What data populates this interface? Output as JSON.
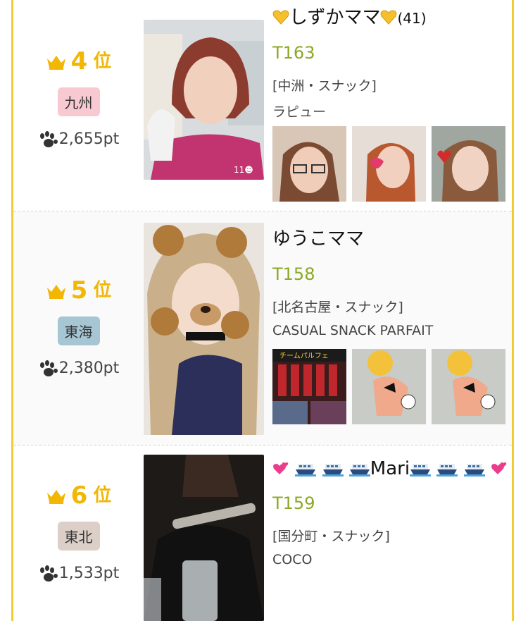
{
  "rankings": [
    {
      "rank": "4",
      "rank_suffix": "位",
      "region": "九州",
      "region_color": "#f9c9d2",
      "points": "2,655pt",
      "name": "しずかママ",
      "age": "(41)",
      "height": "T163",
      "category": "[中洲・スナック]",
      "shop": "ラピュー",
      "photo_badge": "11☻"
    },
    {
      "rank": "5",
      "rank_suffix": "位",
      "region": "東海",
      "region_color": "#a6c6d4",
      "points": "2,380pt",
      "name": "ゆうこママ",
      "height": "T158",
      "category": "[北名古屋・スナック]",
      "shop": "CASUAL SNACK PARFAIT",
      "thumb_label": "チームパルフェ"
    },
    {
      "rank": "6",
      "rank_suffix": "位",
      "region": "東北",
      "region_color": "#dccfc8",
      "points": "1,533pt",
      "name": "Mari",
      "height": "T159",
      "category": "[国分町・スナック]",
      "shop": "COCO"
    }
  ],
  "colors": {
    "accent": "#f2b705",
    "border": "#f2cc33",
    "height_text": "#8ba825"
  }
}
